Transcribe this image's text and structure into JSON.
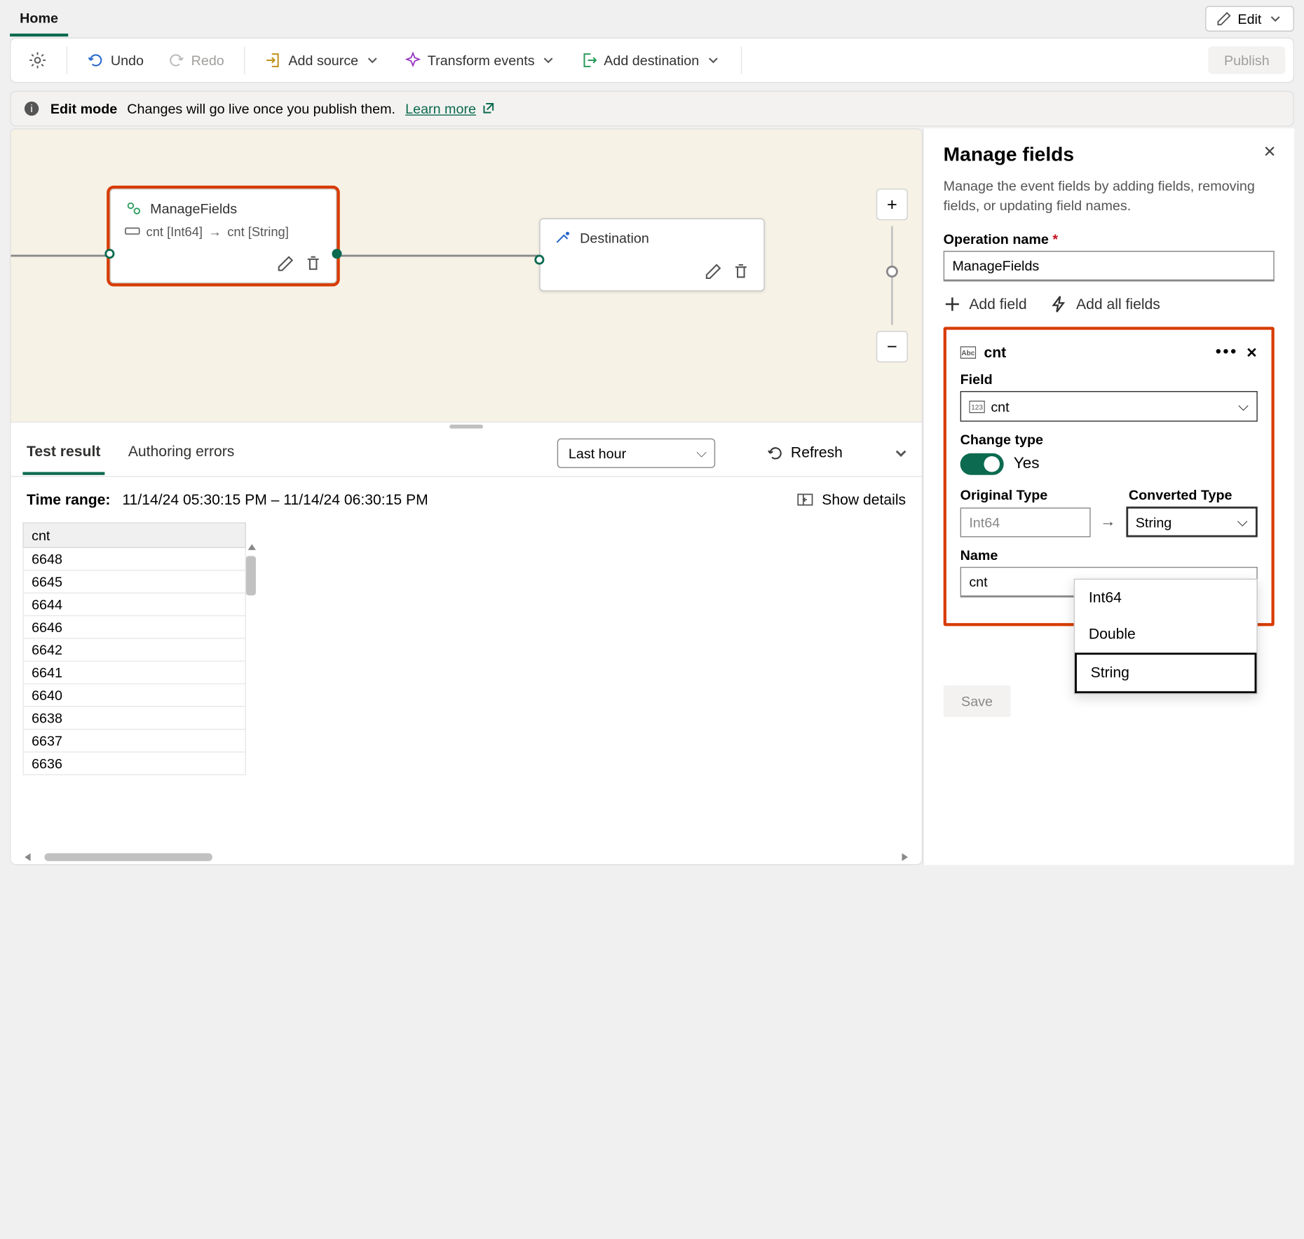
{
  "tabs": {
    "home": "Home"
  },
  "edit_button": "Edit",
  "toolbar": {
    "undo": "Undo",
    "redo": "Redo",
    "add_source": "Add source",
    "transform_events": "Transform events",
    "add_destination": "Add destination",
    "publish": "Publish"
  },
  "info": {
    "title": "Edit mode",
    "text": "Changes will go live once you publish them.",
    "link": "Learn more"
  },
  "canvas": {
    "manage_node": {
      "title": "ManageFields",
      "mapping_from": "cnt [Int64]",
      "mapping_to": "cnt [String]"
    },
    "dest_node": {
      "title": "Destination"
    }
  },
  "results": {
    "tab_test": "Test result",
    "tab_errors": "Authoring errors",
    "time_filter": "Last hour",
    "refresh": "Refresh",
    "time_range_label": "Time range:",
    "time_range_value": "11/14/24 05:30:15 PM  –  11/14/24 06:30:15 PM",
    "show_details": "Show details",
    "column": "cnt",
    "rows": [
      "6648",
      "6645",
      "6644",
      "6646",
      "6642",
      "6641",
      "6640",
      "6638",
      "6637",
      "6636"
    ]
  },
  "panel": {
    "title": "Manage fields",
    "desc": "Manage the event fields by adding fields, removing fields, or updating field names.",
    "op_label": "Operation name",
    "op_value": "ManageFields",
    "add_field": "Add field",
    "add_all": "Add all fields",
    "field_name": "cnt",
    "field_label": "Field",
    "field_value": "cnt",
    "change_type_label": "Change type",
    "change_type_value": "Yes",
    "original_label": "Original Type",
    "original_value": "Int64",
    "converted_label": "Converted Type",
    "converted_value": "String",
    "name_label": "Name",
    "name_value": "cnt",
    "type_options": [
      "Int64",
      "Double",
      "String"
    ],
    "save": "Save"
  }
}
